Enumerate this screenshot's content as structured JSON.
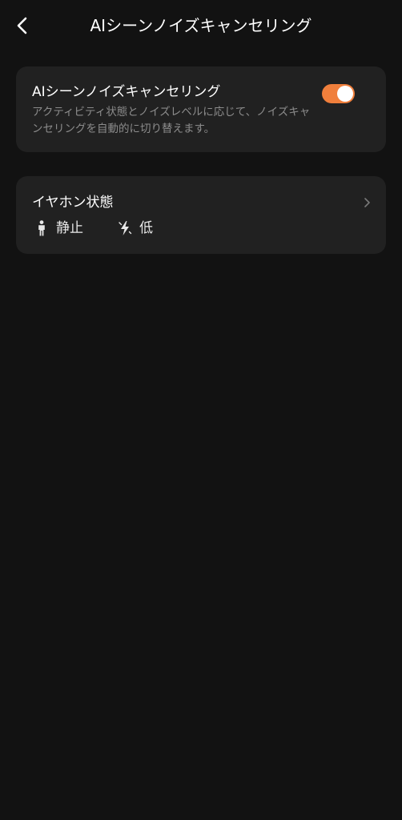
{
  "header": {
    "title": "AIシーンノイズキャンセリング",
    "back_icon": "chevron-left-icon"
  },
  "ai_noise_cancelling": {
    "title": "AIシーンノイズキャンセリング",
    "description": "アクティビティ状態とノイズレベルに応じて、ノイズキャンセリングを自動的に切り替えます。",
    "enabled": true,
    "toggle_color": "#f07f3c"
  },
  "earphone_status": {
    "title": "イヤホン状態",
    "chevron_icon": "chevron-right-icon",
    "activity": {
      "icon": "person-standing-icon",
      "label": "静止"
    },
    "noise": {
      "icon": "noise-level-icon",
      "label": "低"
    }
  },
  "colors": {
    "background": "#121212",
    "card": "#212121",
    "accent": "#f07f3c",
    "secondary_text": "#8c8c8c"
  }
}
